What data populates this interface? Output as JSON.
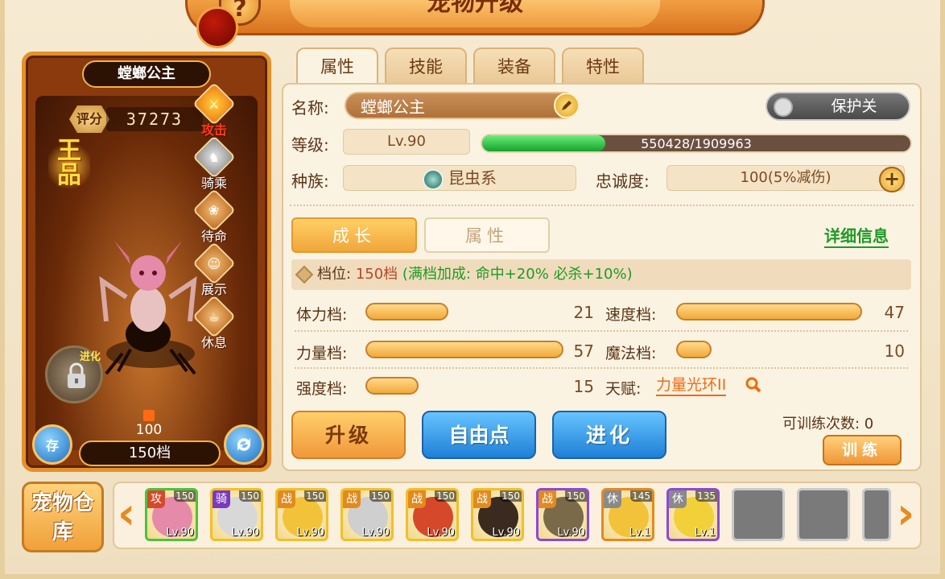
{
  "window": {
    "title": "宠物升级",
    "help_label": "?"
  },
  "pet_card": {
    "name": "螳螂公主",
    "score_label": "评分",
    "score": "37273",
    "grade_badge": "王品",
    "actions": [
      {
        "label": "攻击",
        "icon": "sword-icon",
        "state": "active"
      },
      {
        "label": "骑乘",
        "icon": "horse-icon",
        "state": "grey"
      },
      {
        "label": "待命",
        "icon": "paw-icon",
        "state": "normal"
      },
      {
        "label": "展示",
        "icon": "face-icon",
        "state": "normal"
      },
      {
        "label": "休息",
        "icon": "cup-icon",
        "state": "normal"
      }
    ],
    "evolve_label": "进化",
    "exp_num": "100",
    "tier": "150档",
    "save_label": "存"
  },
  "tabs": [
    {
      "label": "属性",
      "active": true
    },
    {
      "label": "技能",
      "active": false
    },
    {
      "label": "装备",
      "active": false
    },
    {
      "label": "特性",
      "active": false
    }
  ],
  "info": {
    "name_label": "名称:",
    "name_value": "螳螂公主",
    "protect_label": "保护关",
    "level_label": "等级:",
    "level_value": "Lv.90",
    "exp_text": "550428/1909963",
    "exp_fraction": 0.288,
    "race_label": "种族:",
    "race_value": "昆虫系",
    "loyalty_label": "忠诚度:",
    "loyalty_value": "100(5%减伤)"
  },
  "growth": {
    "tab_growth": "成长",
    "tab_attr": "属性",
    "detail_link": "详细信息",
    "grade_label": "档位:",
    "grade_value": "150档",
    "grade_bonus": "(满档加成: 命中+20% 必杀+10%)",
    "stats": [
      {
        "label": "体力档:",
        "value": "21",
        "fraction": 0.42
      },
      {
        "label": "速度档:",
        "value": "47",
        "fraction": 0.94
      },
      {
        "label": "力量档:",
        "value": "57",
        "fraction": 1.0
      },
      {
        "label": "魔法档:",
        "value": "10",
        "fraction": 0.18
      },
      {
        "label": "强度档:",
        "value": "15",
        "fraction": 0.27
      }
    ],
    "talent_label": "天赋:",
    "talent_value": "力量光环II"
  },
  "buttons": {
    "upgrade": "升级",
    "free_points": "自由点",
    "evolve": "进化",
    "train_count_label": "可训练次数: 0",
    "train": "训练"
  },
  "storage": {
    "label": "宠物仓库",
    "slots": [
      {
        "type": "攻",
        "stars": "150",
        "level": "Lv.90",
        "type_color": "#d44a2a",
        "art": "#e58aa8",
        "border": "#4fc23a"
      },
      {
        "type": "骑",
        "stars": "150",
        "level": "Lv.90",
        "type_color": "#7a3ac0",
        "art": "#d8d8d8",
        "border": "#f0c02a"
      },
      {
        "type": "战",
        "stars": "150",
        "level": "Lv.90",
        "type_color": "#e38a1e",
        "art": "#f2c33a",
        "border": "#f0c02a"
      },
      {
        "type": "战",
        "stars": "150",
        "level": "Lv.90",
        "type_color": "#e38a1e",
        "art": "#cfcfcf",
        "border": "#f0c02a"
      },
      {
        "type": "战",
        "stars": "150",
        "level": "Lv.90",
        "type_color": "#e38a1e",
        "art": "#d5482a",
        "border": "#f0c02a"
      },
      {
        "type": "战",
        "stars": "150",
        "level": "Lv.90",
        "type_color": "#e38a1e",
        "art": "#3a2a20",
        "border": "#f0c02a"
      },
      {
        "type": "战",
        "stars": "150",
        "level": "Lv.90",
        "type_color": "#e38a1e",
        "art": "#7a6a4a",
        "border": "#8a4ad8"
      },
      {
        "type": "休",
        "stars": "145",
        "level": "Lv.1",
        "type_color": "#8a8a8a",
        "art": "#f2c33a",
        "border": "#e38a1e"
      },
      {
        "type": "休",
        "stars": "135",
        "level": "Lv.1",
        "type_color": "#8a8a8a",
        "art": "#f2d03a",
        "border": "#8a4ad8"
      }
    ]
  }
}
